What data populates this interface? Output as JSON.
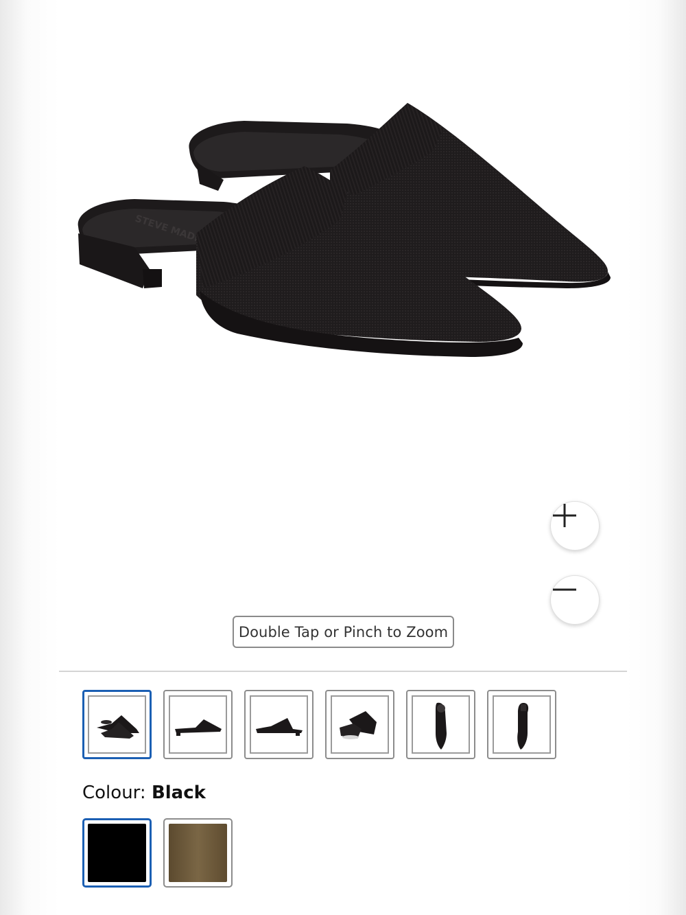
{
  "hero": {
    "brand_imprint": "STEVE MADDEN",
    "zoom_hint": "Double Tap or Pinch to Zoom"
  },
  "zoom": {
    "zoom_in_icon": "plus-icon",
    "zoom_out_icon": "minus-icon"
  },
  "thumbnails": [
    {
      "view": "pair-angled",
      "selected": true
    },
    {
      "view": "side-profile",
      "selected": false
    },
    {
      "view": "side-profile-alt",
      "selected": false
    },
    {
      "view": "pair-back",
      "selected": false
    },
    {
      "view": "top-down",
      "selected": false
    },
    {
      "view": "sole-bottom",
      "selected": false
    }
  ],
  "colour": {
    "label": "Colour:",
    "selected_value": "Black",
    "swatches": [
      {
        "name": "Black",
        "color": "#000000",
        "selected": true
      },
      {
        "name": "Brown",
        "color": "#6b5738",
        "selected": false
      }
    ]
  },
  "colors": {
    "accent": "#1b5fb3",
    "divider": "#d4d4d4"
  }
}
